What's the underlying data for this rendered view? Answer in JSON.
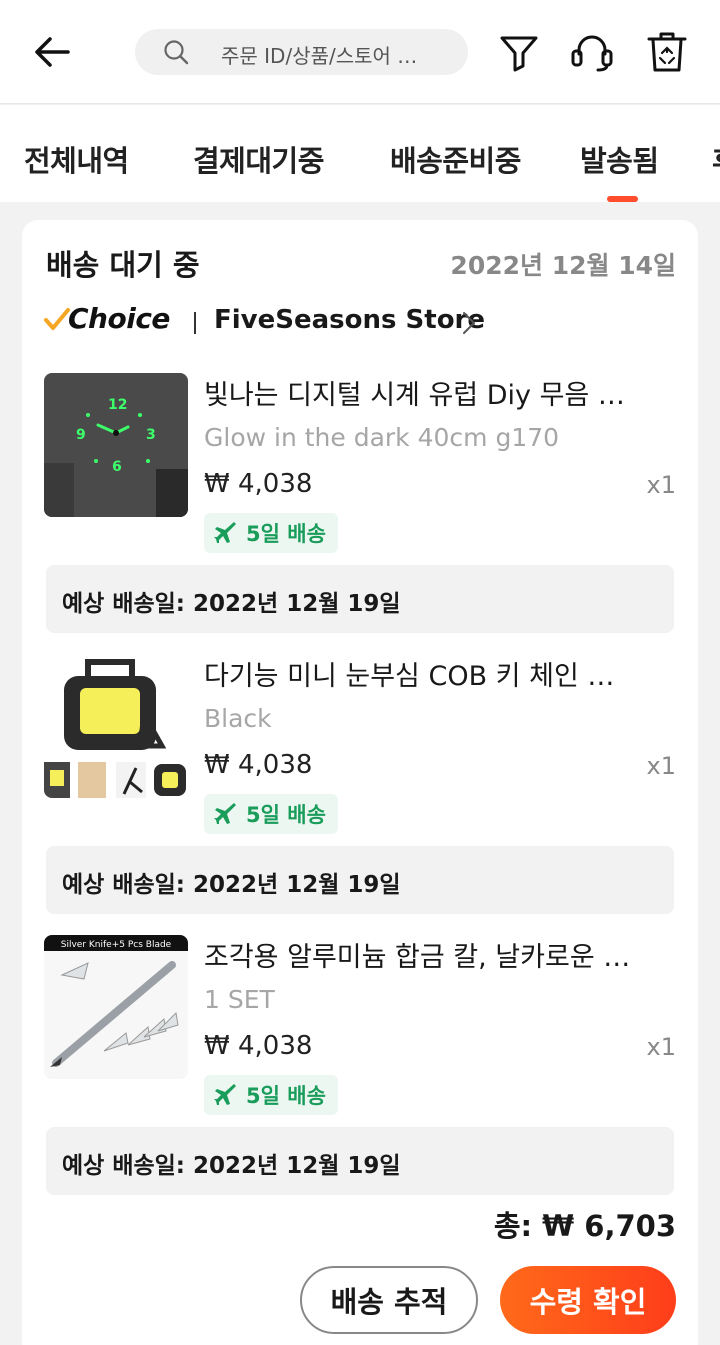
{
  "header": {
    "search_placeholder": "주문 ID/상품/스토어 …"
  },
  "tabs": [
    {
      "label": "전체내역"
    },
    {
      "label": "결제대기중"
    },
    {
      "label": "배송준비중"
    },
    {
      "label": "발송됨",
      "active": true
    },
    {
      "label": "후"
    }
  ],
  "order": {
    "status": "배송 대기 중",
    "date": "2022년 12월 14일",
    "choice_label": "Choice",
    "store_name": "FiveSeasons Store",
    "items": [
      {
        "title": "빛나는 디지털 시계 유럽 Diy 무음 …",
        "variant": "Glow in the dark 40cm g170",
        "price": "₩ 4,038",
        "qty": "x1",
        "shipping": "5일 배송",
        "eta": "예상 배송일: 2022년 12월 19일"
      },
      {
        "title": "다기능 미니 눈부심 COB 키 체인 …",
        "variant": "Black",
        "price": "₩ 4,038",
        "qty": "x1",
        "shipping": "5일 배송",
        "eta": "예상 배송일: 2022년 12월 19일"
      },
      {
        "title": "조각용 알루미늄 합금 칼, 날카로운 …",
        "variant": "1 SET",
        "price": "₩ 4,038",
        "qty": "x1",
        "shipping": "5일 배송",
        "eta": "예상 배송일: 2022년 12월 19일",
        "thumb_caption": "Silver Knife+5 Pcs Blade"
      }
    ],
    "total": "총: ₩ 6,703",
    "track_label": "배송 추적",
    "confirm_label": "수령 확인"
  },
  "colors": {
    "accent": "#ff4d2d",
    "shipping_green": "#1a9c5b",
    "choice_check": "#f5a623"
  }
}
